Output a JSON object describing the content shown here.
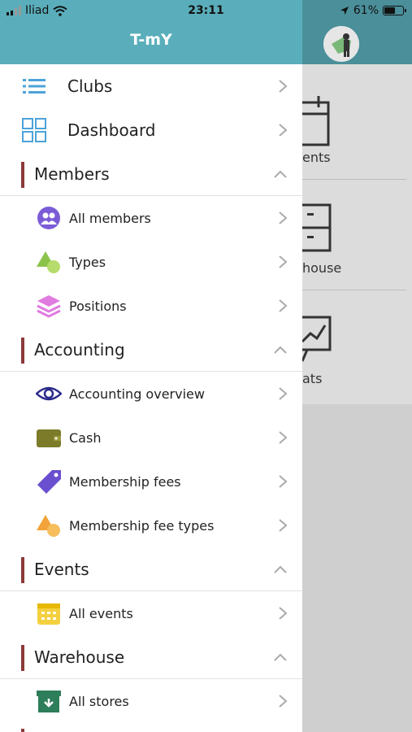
{
  "status_bar": {
    "carrier": "Iliad",
    "time": "23:11",
    "battery_percent": "61%"
  },
  "drawer": {
    "title": "T-mY",
    "top_items": [
      {
        "label": "Clubs",
        "icon": "list-icon"
      },
      {
        "label": "Dashboard",
        "icon": "grid-icon"
      }
    ],
    "sections": [
      {
        "label": "Members",
        "items": [
          {
            "label": "All members",
            "icon": "people-icon",
            "color": "#7b5cd6"
          },
          {
            "label": "Types",
            "icon": "shapes-icon",
            "color": "#8bc34a"
          },
          {
            "label": "Positions",
            "icon": "layers-icon",
            "color": "#e07be0"
          }
        ]
      },
      {
        "label": "Accounting",
        "items": [
          {
            "label": "Accounting overview",
            "icon": "eye-icon",
            "color": "#2b2b8a"
          },
          {
            "label": "Cash",
            "icon": "wallet-icon",
            "color": "#7b7b2a"
          },
          {
            "label": "Membership fees",
            "icon": "tag-icon",
            "color": "#6a4fcf"
          },
          {
            "label": "Membership fee types",
            "icon": "shapes-icon",
            "color": "#f2a33a"
          }
        ]
      },
      {
        "label": "Events",
        "items": [
          {
            "label": "All events",
            "icon": "calendar-icon",
            "color": "#f4d03f"
          }
        ]
      },
      {
        "label": "Warehouse",
        "items": [
          {
            "label": "All stores",
            "icon": "archive-icon",
            "color": "#2e7d5b"
          }
        ]
      }
    ]
  },
  "background": {
    "tiles": [
      "ents",
      "house",
      "ats"
    ]
  },
  "colors": {
    "header": "#5aaebb",
    "section_bar": "#8b3a3a"
  }
}
